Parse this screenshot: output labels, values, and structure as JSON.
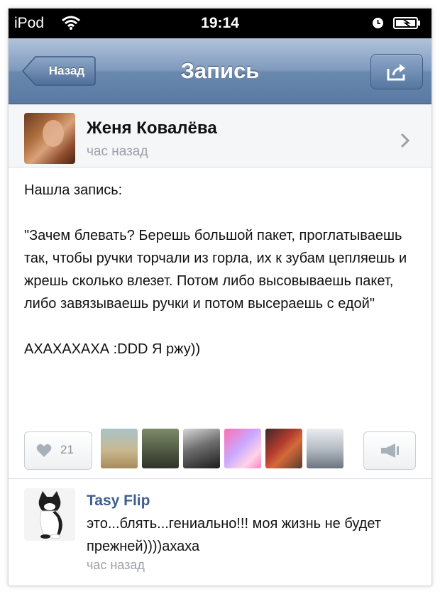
{
  "status_bar": {
    "carrier": "iPod",
    "time": "19:14",
    "icons": [
      "wifi-icon",
      "clock-icon",
      "battery-icon"
    ]
  },
  "nav": {
    "back_label": "Назад",
    "title": "Запись",
    "share_icon": "share-icon"
  },
  "post": {
    "author": "Женя Ковалёва",
    "time": "час назад",
    "paragraphs": [
      "Нашла запись:",
      "\"Зачем блевать? Берешь большой пакет, проглатываешь так, чтобы ручки торчали из горла, их к зубам цепляешь и жрешь сколько влезет. Потом либо высовываешь пакет, либо завязываешь ручки и потом высераешь с едой\"",
      "АХАХАХАХА :DDD Я ржу))"
    ],
    "like_count": "21",
    "like_icon": "heart-icon",
    "repost_icon": "megaphone-icon"
  },
  "comment": {
    "author": "Tasy Flip",
    "text": "это...блять...гениально!!! моя жизнь не будет прежней))))ахаха",
    "time": "час назад"
  },
  "colors": {
    "navbar": "#6a89af",
    "link": "#3f5f8f",
    "muted": "#9aa0a8"
  }
}
